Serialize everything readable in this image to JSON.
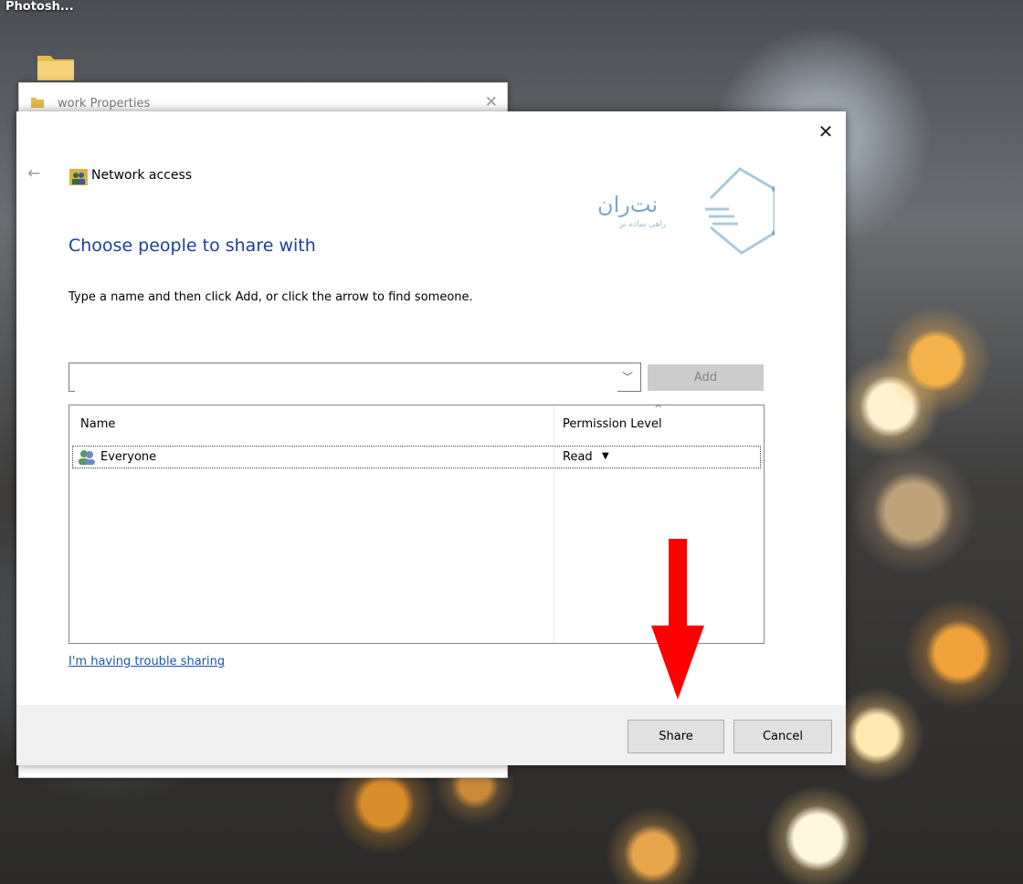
{
  "desktop": {
    "top_label": "Photosh..."
  },
  "background_window": {
    "title": "work Properties"
  },
  "dialog": {
    "title": "Network access",
    "logo_text": "نت‌ران",
    "logo_subtext": "راهی ساده تر",
    "heading": "Choose people to share with",
    "instructions": "Type a name and then click Add, or click the arrow to find someone.",
    "name_input": {
      "value": "",
      "placeholder": ""
    },
    "add_label": "Add",
    "table": {
      "columns": [
        "Name",
        "Permission Level"
      ],
      "rows": [
        {
          "name": "Everyone",
          "permission": "Read"
        }
      ]
    },
    "trouble_link": "I'm having trouble sharing",
    "share_label": "Share",
    "cancel_label": "Cancel"
  },
  "colors": {
    "heading": "#1d3f9a",
    "link": "#1a55b0",
    "annotation_arrow": "#ff0000",
    "logo": "#7aa9c6"
  }
}
